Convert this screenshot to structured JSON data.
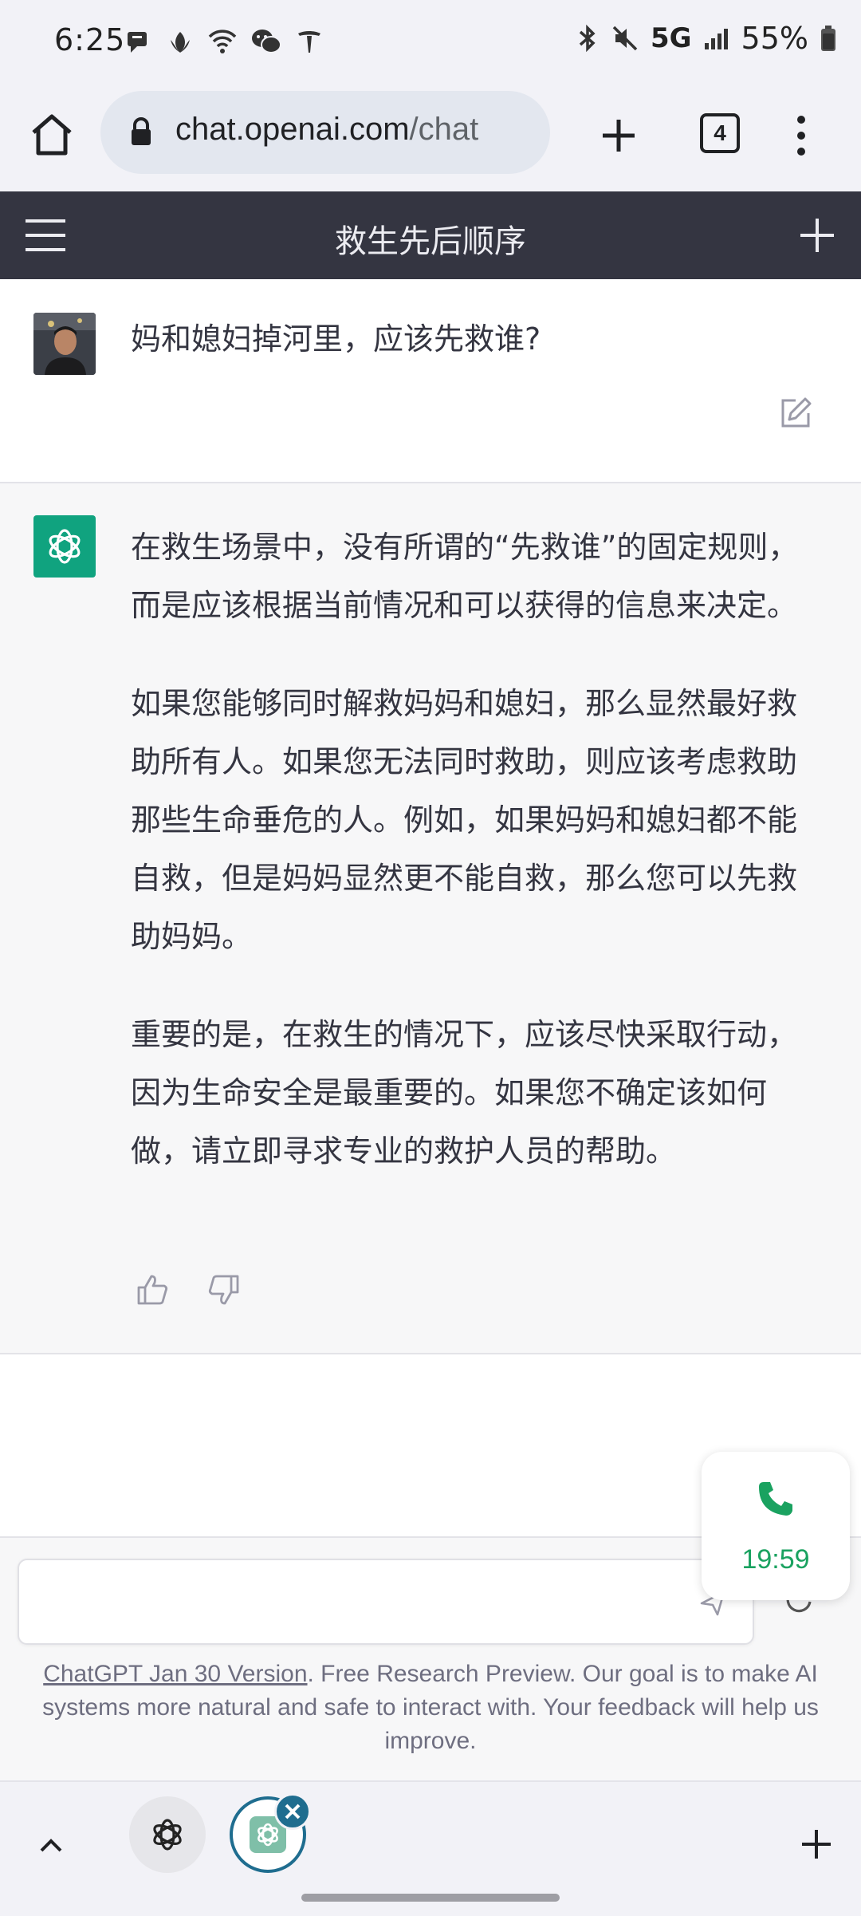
{
  "status_bar": {
    "time": "6:25",
    "network": "5G",
    "battery": "55%",
    "icons": [
      "message-icon",
      "leaf-icon",
      "wifi-icon",
      "wechat-icon",
      "tesla-icon",
      "bluetooth-icon",
      "mute-icon",
      "signal-icon",
      "battery-icon"
    ]
  },
  "browser": {
    "url_host": "chat.openai.com",
    "url_path": "/chat",
    "tab_count": "4"
  },
  "chat": {
    "title": "救生先后顺序"
  },
  "messages": {
    "user": {
      "text": "妈和媳妇掉河里，应该先救谁?"
    },
    "assistant": {
      "paragraphs": [
        "在救生场景中，没有所谓的“先救谁”的固定规则，而是应该根据当前情况和可以获得的信息来决定。",
        "如果您能够同时解救妈妈和媳妇，那么显然最好救助所有人。如果您无法同时救助，则应该考虑救助那些生命垂危的人。例如，如果妈妈和媳妇都不能自救，但是妈妈显然更不能自救，那么您可以先救助妈妈。",
        "重要的是，在救生的情况下，应该尽快采取行动，因为生命安全是最重要的。如果您不确定该如何做，请立即寻求专业的救护人员的帮助。"
      ]
    }
  },
  "input": {
    "placeholder": ""
  },
  "footer": {
    "version_link": "ChatGPT Jan 30 Version",
    "disclaimer": ". Free Research Preview. Our goal is to make AI systems more natural and safe to interact with. Your feedback will help us improve."
  },
  "call": {
    "timer": "19:59"
  },
  "colors": {
    "header_bg": "#343541",
    "assistant_bg": "#f7f7f8",
    "brand_green": "#10a37f",
    "call_green": "#1aa260"
  }
}
